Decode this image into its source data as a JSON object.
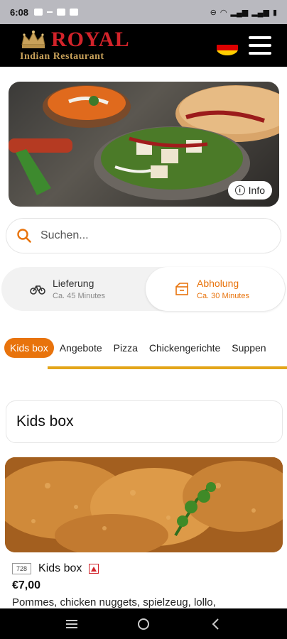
{
  "status": {
    "time": "6:08"
  },
  "header": {
    "brand_name": "ROYAL",
    "brand_sub": "Indian Restaurant",
    "flag_colors": [
      "#000000",
      "#dd0000",
      "#ffce00"
    ]
  },
  "hero": {
    "info_label": "Info"
  },
  "search": {
    "placeholder": "Suchen..."
  },
  "modes": {
    "delivery": {
      "title": "Lieferung",
      "eta": "Ca. 45 Minutes",
      "icon": "bicycle-icon"
    },
    "pickup": {
      "title": "Abholung",
      "eta": "Ca. 30 Minutes",
      "icon": "pickup-box-icon",
      "selected": true
    }
  },
  "categories": [
    "Kids box",
    "Angebote",
    "Pizza",
    "Chickengerichte",
    "Suppen"
  ],
  "active_category": "Kids box",
  "section": {
    "title": "Kids box"
  },
  "product": {
    "number": "728",
    "name": "Kids box",
    "price": "€7,00",
    "description": "Pommes, chicken nuggets, spielzeug, lollo,"
  },
  "colors": {
    "accent": "#e8730c",
    "brand_red": "#d2232a",
    "underline": "#e3a51a"
  }
}
